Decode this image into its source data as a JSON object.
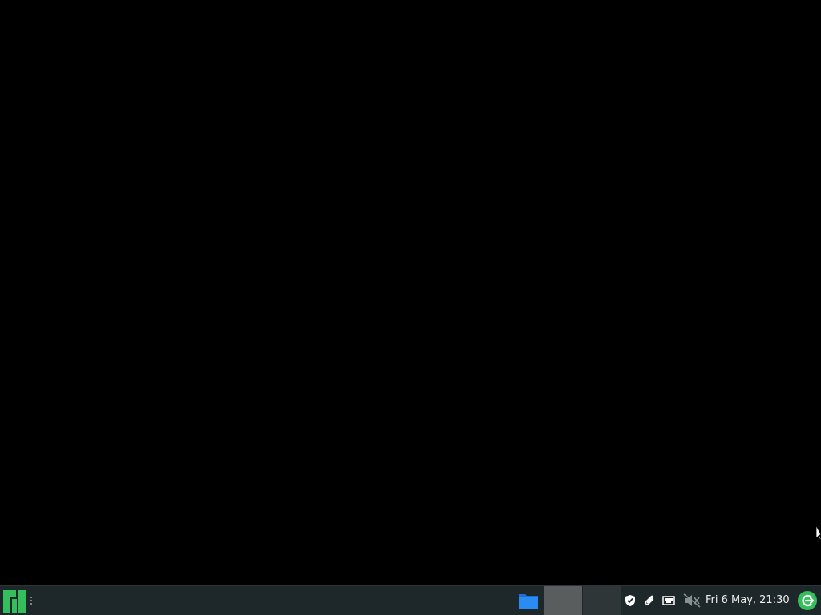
{
  "desktop": {
    "background": "#000000"
  },
  "panel": {
    "background": "#1e2729",
    "accent": "#35bf5c",
    "app_menu_icon": "manjaro-logo-icon",
    "taskbar": {
      "items": [
        {
          "icon": "file-manager-icon"
        }
      ]
    },
    "pager": {
      "desktops": [
        {
          "active": true
        },
        {
          "active": false
        }
      ]
    },
    "tray": {
      "icons": [
        "shield-check-icon",
        "paperclip-icon",
        "network-wired-icon",
        "volume-muted-icon"
      ]
    },
    "clock": {
      "text": "Fri  6 May, 21:30"
    },
    "power_icon": "logout-power-icon"
  }
}
